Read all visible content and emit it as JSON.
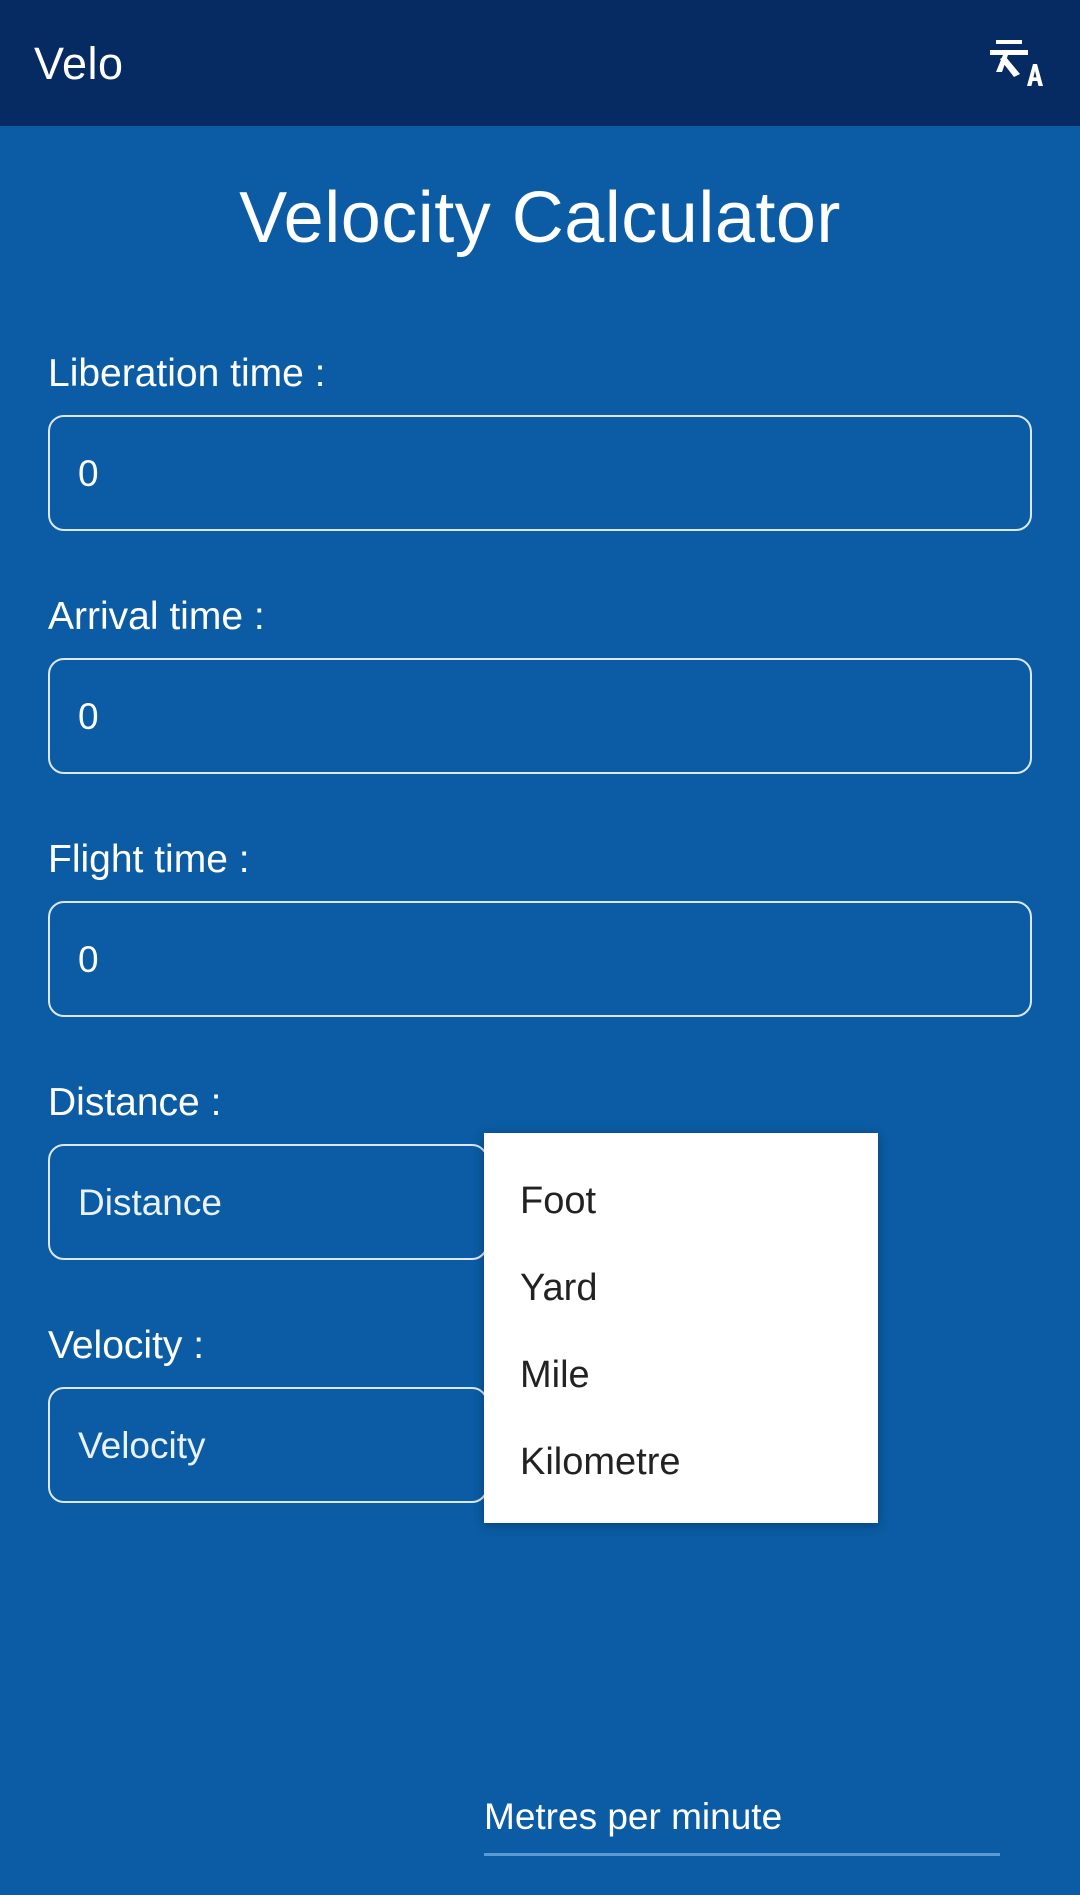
{
  "appbar": {
    "title": "Velo",
    "translate_icon": "translate-icon"
  },
  "page": {
    "title": "Velocity Calculator"
  },
  "fields": [
    {
      "label": "Liberation time :",
      "value": "0",
      "placeholder": ""
    },
    {
      "label": "Arrival time :",
      "value": "0",
      "placeholder": ""
    },
    {
      "label": "Flight time :",
      "value": "0",
      "placeholder": ""
    },
    {
      "label": "Distance :",
      "value": "",
      "placeholder": "Distance"
    },
    {
      "label": "Velocity :",
      "value": "",
      "placeholder": "Velocity"
    }
  ],
  "velocity_unit_spinner": {
    "selected": "Metres per minute"
  },
  "distance_unit_dropdown": {
    "open": true,
    "options": [
      "Foot",
      "Yard",
      "Mile",
      "Kilometre"
    ]
  },
  "colors": {
    "appbar_background": "#062b63",
    "page_background": "#0b5ca4",
    "field_border": "#dce9f5",
    "text_on_blue": "#ffffff",
    "dropdown_background": "#ffffff",
    "dropdown_text": "#222222",
    "spinner_underline": "#5b9bd5"
  }
}
